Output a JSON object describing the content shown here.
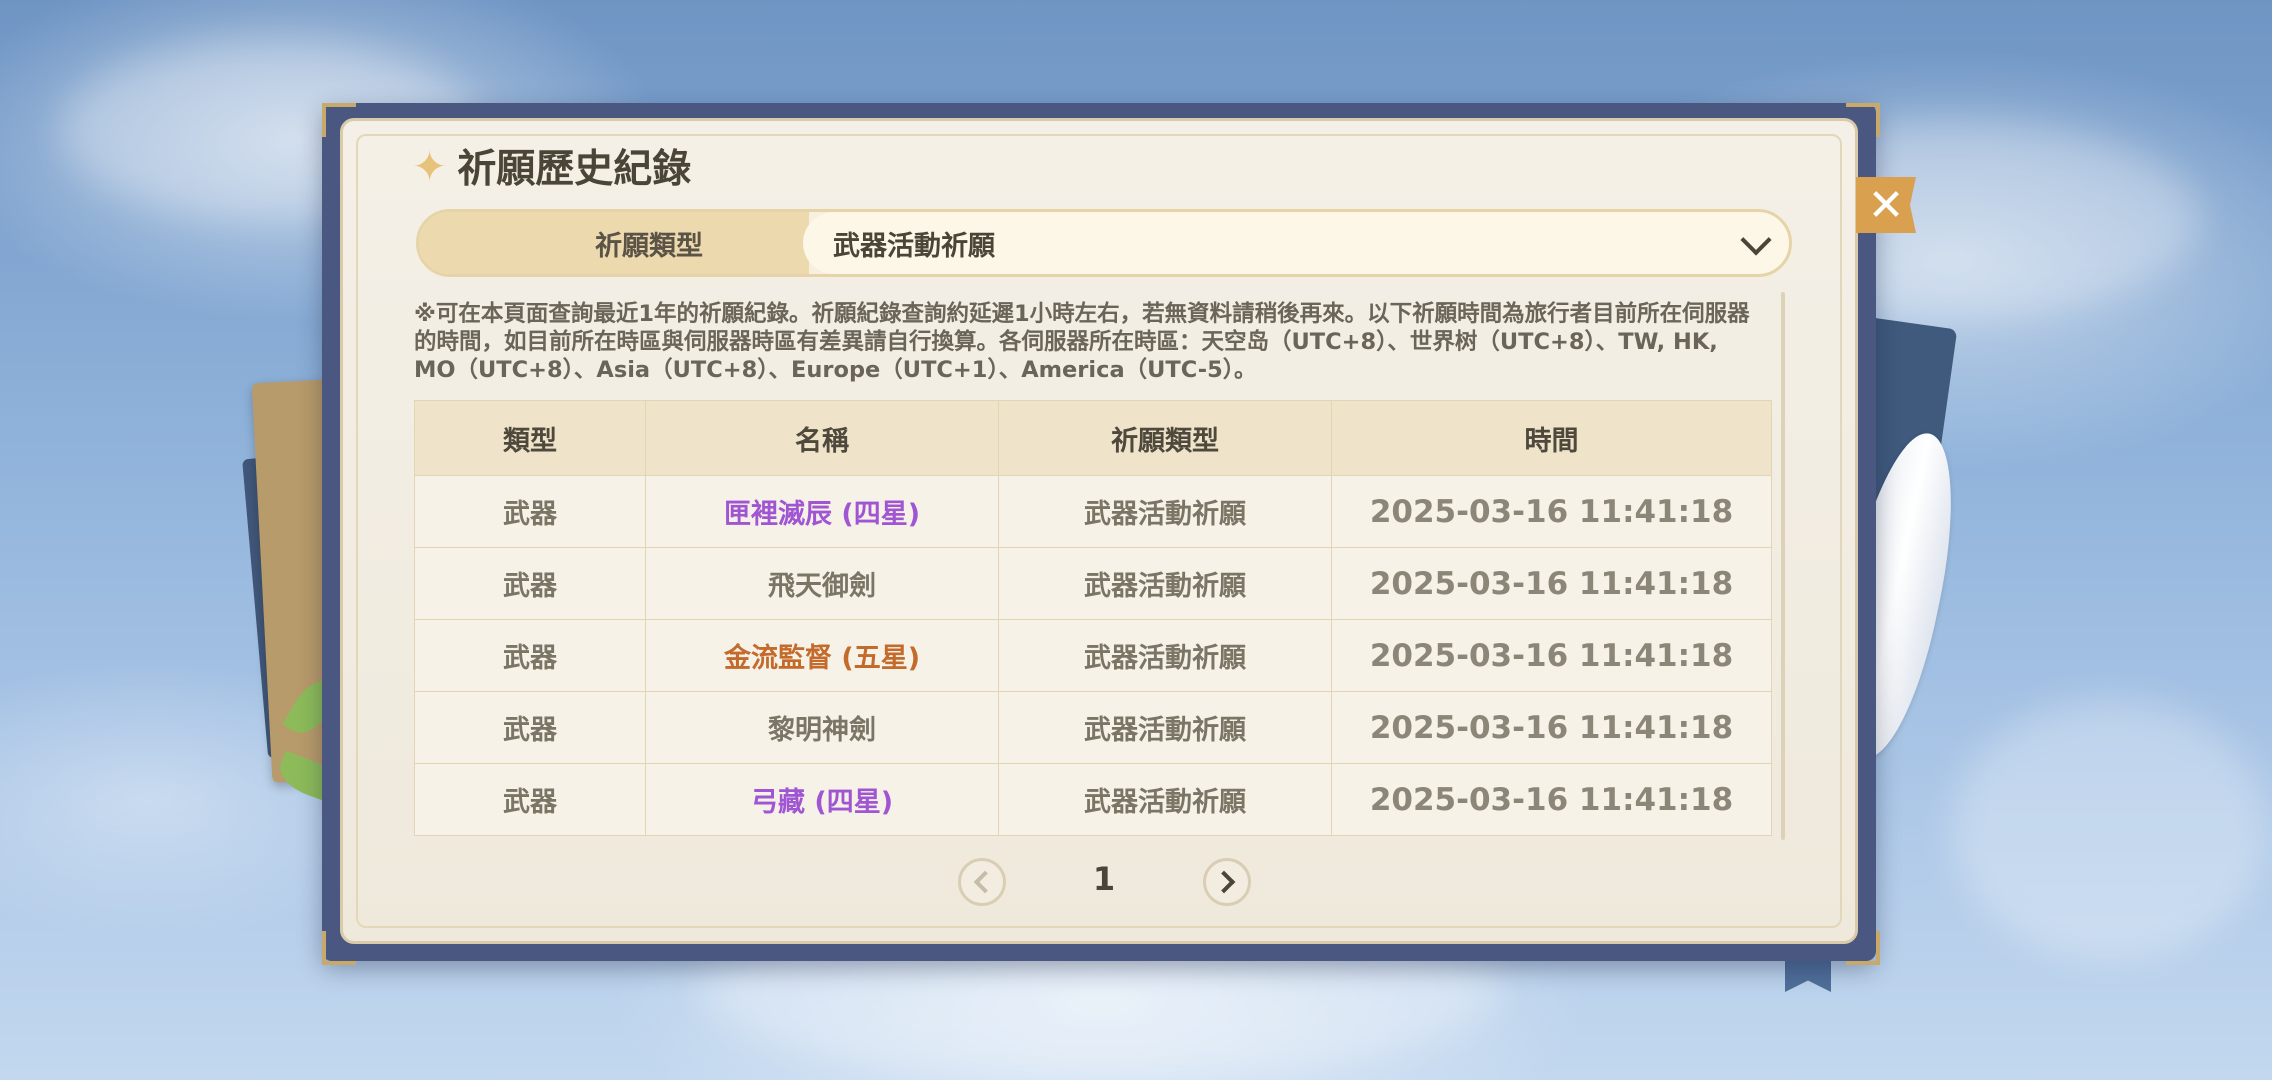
{
  "header": {
    "title": "祈願歷史紀錄"
  },
  "filter": {
    "label": "祈願類型",
    "selected": "武器活動祈願"
  },
  "notice": "※可在本頁面查詢最近1年的祈願紀錄。祈願紀錄查詢約延遲1小時左右，若無資料請稍後再來。以下祈願時間為旅行者目前所在伺服器的時間，如目前所在時區與伺服器時區有差異請自行換算。各伺服器所在時區：天空岛（UTC+8）、世界树（UTC+8）、TW, HK, MO（UTC+8）、Asia（UTC+8）、Europe（UTC+1）、America（UTC-5）。",
  "table": {
    "columns": [
      "類型",
      "名稱",
      "祈願類型",
      "時間"
    ],
    "rows": [
      {
        "type": "武器",
        "name": "匣裡滅辰 (四星)",
        "banner": "武器活動祈願",
        "time": "2025-03-16 11:41:18",
        "rarity": 4
      },
      {
        "type": "武器",
        "name": "飛天御劍",
        "banner": "武器活動祈願",
        "time": "2025-03-16 11:41:18",
        "rarity": 3
      },
      {
        "type": "武器",
        "name": "金流監督 (五星)",
        "banner": "武器活動祈願",
        "time": "2025-03-16 11:41:18",
        "rarity": 5
      },
      {
        "type": "武器",
        "name": "黎明神劍",
        "banner": "武器活動祈願",
        "time": "2025-03-16 11:41:18",
        "rarity": 3
      },
      {
        "type": "武器",
        "name": "弓藏 (四星)",
        "banner": "武器活動祈願",
        "time": "2025-03-16 11:41:18",
        "rarity": 4
      }
    ]
  },
  "pagination": {
    "current": "1"
  },
  "colors": {
    "rare4": "#a055d3",
    "rare5": "#c46a2a",
    "accent": "#d9a050"
  },
  "icons": {
    "title": "sparkle-icon",
    "close": "close-icon",
    "dropdown": "chevron-down-icon",
    "prev": "chevron-left-icon",
    "next": "chevron-right-icon"
  }
}
